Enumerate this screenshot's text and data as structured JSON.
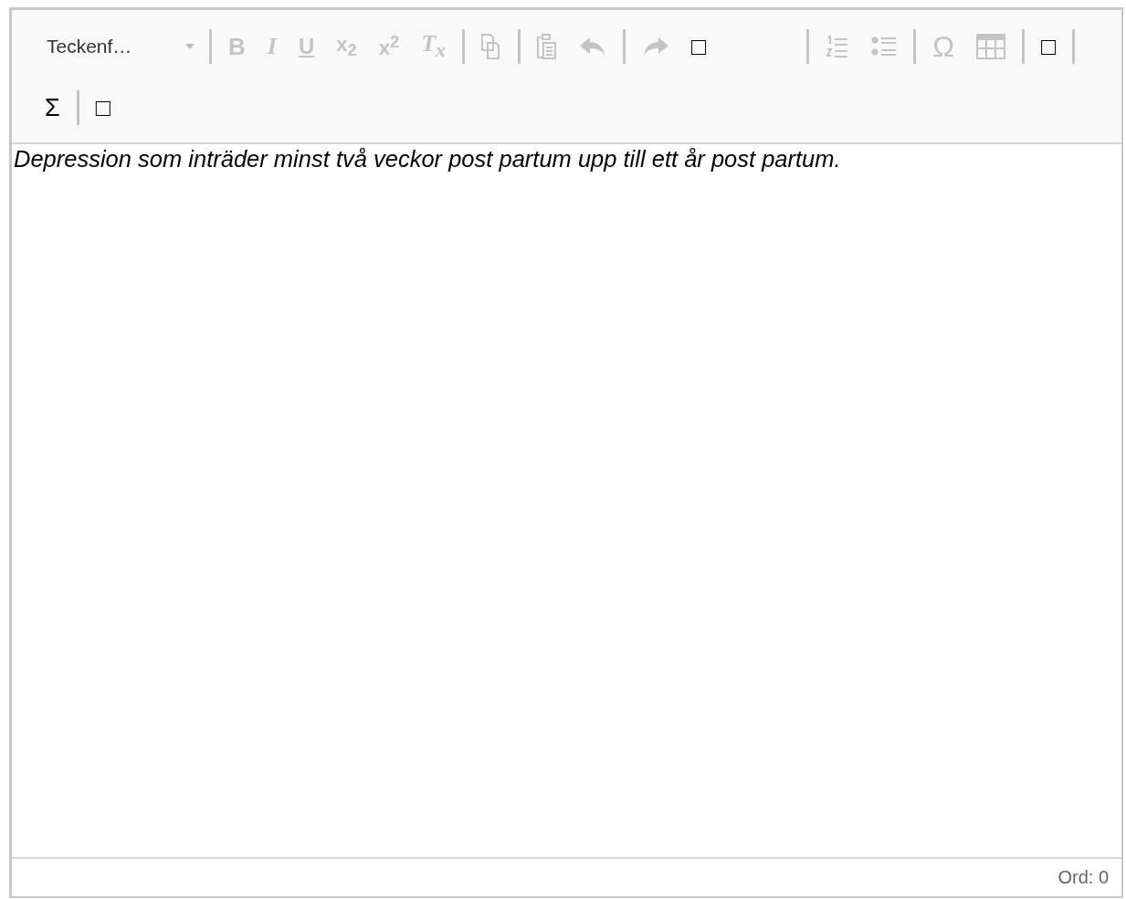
{
  "toolbar": {
    "items": [
      {
        "kind": "dropdown",
        "text": "Teckenf…",
        "disabled": false
      },
      {
        "kind": "separator"
      },
      {
        "kind": "bold",
        "text": "B",
        "disabled": true
      },
      {
        "kind": "italic",
        "text": "I",
        "disabled": true
      },
      {
        "kind": "underline",
        "text": "U",
        "disabled": true
      },
      {
        "kind": "script",
        "text": "x$_{2}$",
        "disabled": true
      },
      {
        "kind": "script",
        "text": "x$^{2}$",
        "disabled": true
      },
      {
        "kind": "italic",
        "text": "T$_{x}$",
        "disabled": true
      },
      {
        "kind": "separator"
      },
      {
        "kind": "copy",
        "disabled": true
      },
      {
        "kind": "separator"
      },
      {
        "kind": "paste",
        "disabled": true
      },
      {
        "kind": "undo",
        "disabled": true
      },
      {
        "kind": "separator"
      },
      {
        "kind": "redo",
        "disabled": true
      },
      {
        "kind": "glyph",
        "text": "□",
        "disabled": false
      },
      {
        "kind": "spacer"
      },
      {
        "kind": "separator"
      },
      {
        "kind": "numbered-list",
        "disabled": true
      },
      {
        "kind": "bullet-list",
        "disabled": true
      },
      {
        "kind": "separator"
      },
      {
        "kind": "glyph",
        "text": "Ω",
        "disabled": true
      },
      {
        "kind": "table",
        "disabled": true
      },
      {
        "kind": "separator"
      },
      {
        "kind": "glyph",
        "text": "□",
        "disabled": false
      },
      {
        "kind": "separator"
      },
      {
        "kind": "glyph",
        "text": "Σ",
        "disabled": false
      },
      {
        "kind": "separator"
      },
      {
        "kind": "glyph",
        "text": "□",
        "disabled": false
      }
    ]
  },
  "content": {
    "text": "Depression som inträder minst två veckor post partum upp till ett år post partum."
  },
  "status_bar": {
    "word_count": "Ord: 0"
  }
}
